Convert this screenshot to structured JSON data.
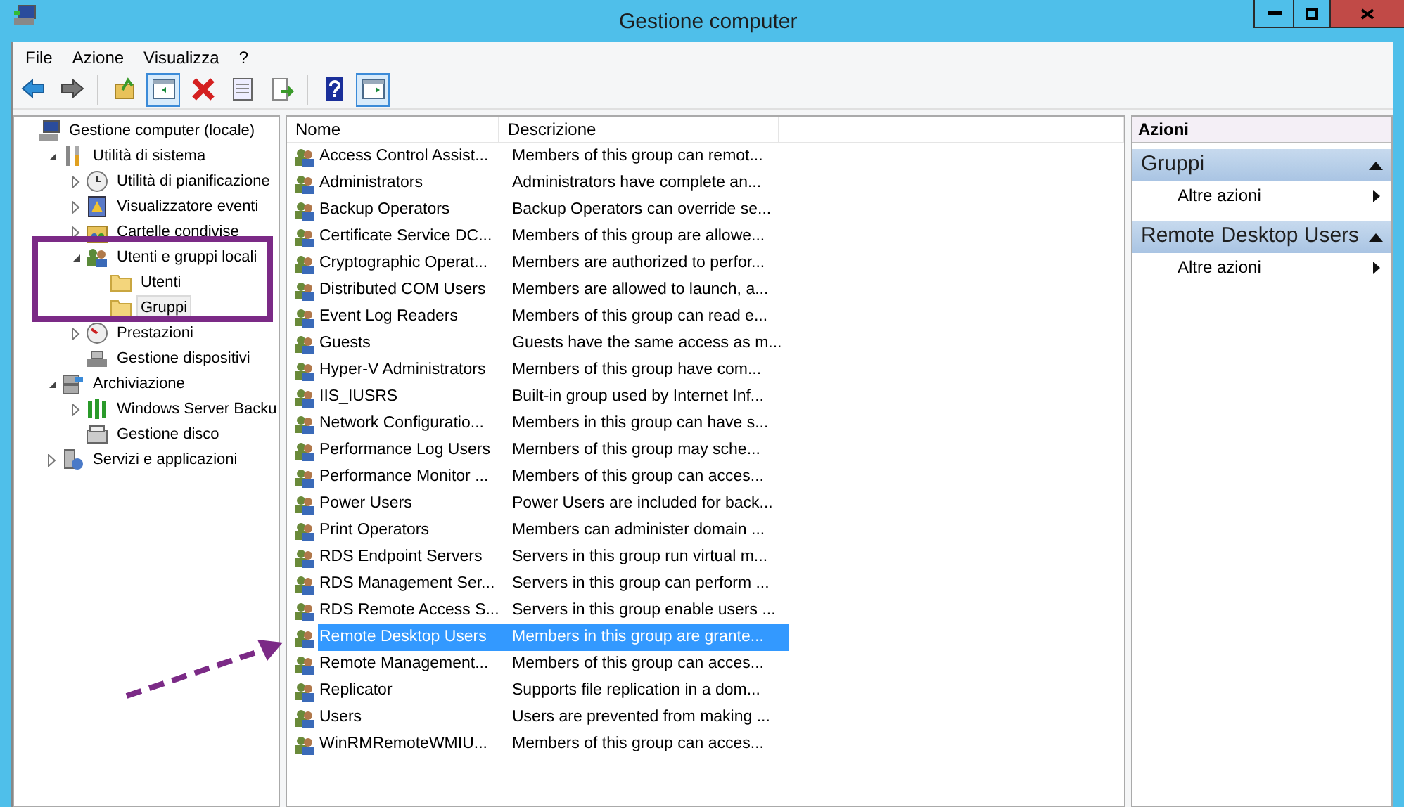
{
  "window": {
    "title": "Gestione computer"
  },
  "menu": [
    "File",
    "Azione",
    "Visualizza",
    "?"
  ],
  "toolbar": [
    {
      "kind": "back",
      "pressed": false
    },
    {
      "kind": "forward",
      "pressed": false
    },
    {
      "kind": "sep"
    },
    {
      "kind": "up",
      "pressed": false
    },
    {
      "kind": "tree",
      "pressed": true
    },
    {
      "kind": "delete",
      "pressed": false
    },
    {
      "kind": "properties",
      "pressed": false
    },
    {
      "kind": "export",
      "pressed": false
    },
    {
      "kind": "sep"
    },
    {
      "kind": "help",
      "pressed": false
    },
    {
      "kind": "pane",
      "pressed": true
    }
  ],
  "tree": [
    {
      "label": "Gestione computer (locale)",
      "kind": "computer",
      "selected": false,
      "children": [
        {
          "label": "Utilità di sistema",
          "kind": "tools",
          "expanded": true,
          "selected": false,
          "children": [
            {
              "label": "Utilità di pianificazione",
              "kind": "clock",
              "expanded": false,
              "selected": false
            },
            {
              "label": "Visualizzatore eventi",
              "kind": "event",
              "expanded": false,
              "selected": false
            },
            {
              "label": "Cartelle condivise",
              "kind": "share",
              "expanded": false,
              "selected": false
            },
            {
              "label": "Utenti e gruppi locali",
              "kind": "users",
              "expanded": true,
              "selected": false,
              "children": [
                {
                  "label": "Utenti",
                  "kind": "folder",
                  "selected": false
                },
                {
                  "label": "Gruppi",
                  "kind": "folder",
                  "selected": true
                }
              ]
            },
            {
              "label": "Prestazioni",
              "kind": "gauge",
              "expanded": false,
              "selected": false
            },
            {
              "label": "Gestione dispositivi",
              "kind": "device",
              "selected": false
            }
          ]
        },
        {
          "label": "Archiviazione",
          "kind": "storage",
          "expanded": true,
          "selected": false,
          "children": [
            {
              "label": "Windows Server Backu",
              "kind": "backup",
              "expanded": false,
              "selected": false
            },
            {
              "label": "Gestione disco",
              "kind": "disk",
              "selected": false
            }
          ]
        },
        {
          "label": "Servizi e applicazioni",
          "kind": "services",
          "expanded": false,
          "selected": false
        }
      ]
    }
  ],
  "table": {
    "columns": [
      "Nome",
      "Descrizione"
    ],
    "rows": [
      {
        "name": "Access Control Assist...",
        "description": "Members of this group can remot...",
        "selected": false
      },
      {
        "name": "Administrators",
        "description": "Administrators have complete an...",
        "selected": false
      },
      {
        "name": "Backup Operators",
        "description": "Backup Operators can override se...",
        "selected": false
      },
      {
        "name": "Certificate Service DC...",
        "description": "Members of this group are allowe...",
        "selected": false
      },
      {
        "name": "Cryptographic Operat...",
        "description": "Members are authorized to perfor...",
        "selected": false
      },
      {
        "name": "Distributed COM Users",
        "description": "Members are allowed to launch, a...",
        "selected": false
      },
      {
        "name": "Event Log Readers",
        "description": "Members of this group can read e...",
        "selected": false
      },
      {
        "name": "Guests",
        "description": "Guests have the same access as m...",
        "selected": false
      },
      {
        "name": "Hyper-V Administrators",
        "description": "Members of this group have com...",
        "selected": false
      },
      {
        "name": "IIS_IUSRS",
        "description": "Built-in group used by Internet Inf...",
        "selected": false
      },
      {
        "name": "Network Configuratio...",
        "description": "Members in this group can have s...",
        "selected": false
      },
      {
        "name": "Performance Log Users",
        "description": "Members of this group may sche...",
        "selected": false
      },
      {
        "name": "Performance Monitor ...",
        "description": "Members of this group can acces...",
        "selected": false
      },
      {
        "name": "Power Users",
        "description": "Power Users are included for back...",
        "selected": false
      },
      {
        "name": "Print Operators",
        "description": "Members can administer domain ...",
        "selected": false
      },
      {
        "name": "RDS Endpoint Servers",
        "description": "Servers in this group run virtual m...",
        "selected": false
      },
      {
        "name": "RDS Management Ser...",
        "description": "Servers in this group can perform ...",
        "selected": false
      },
      {
        "name": "RDS Remote Access S...",
        "description": "Servers in this group enable users ...",
        "selected": false
      },
      {
        "name": "Remote Desktop Users",
        "description": "Members in this group are grante...",
        "selected": true
      },
      {
        "name": "Remote Management...",
        "description": "Members of this group can acces...",
        "selected": false
      },
      {
        "name": "Replicator",
        "description": "Supports file replication in a dom...",
        "selected": false
      },
      {
        "name": "Users",
        "description": "Users are prevented from making ...",
        "selected": false
      },
      {
        "name": "WinRMRemoteWMIU...",
        "description": "Members of this group can acces...",
        "selected": false
      }
    ]
  },
  "actions": {
    "title": "Azioni",
    "sections": [
      {
        "title": "Gruppi",
        "expanded": true,
        "items": [
          "Altre azioni"
        ]
      },
      {
        "title": "Remote Desktop Users",
        "expanded": true,
        "items": [
          "Altre azioni"
        ]
      }
    ]
  }
}
